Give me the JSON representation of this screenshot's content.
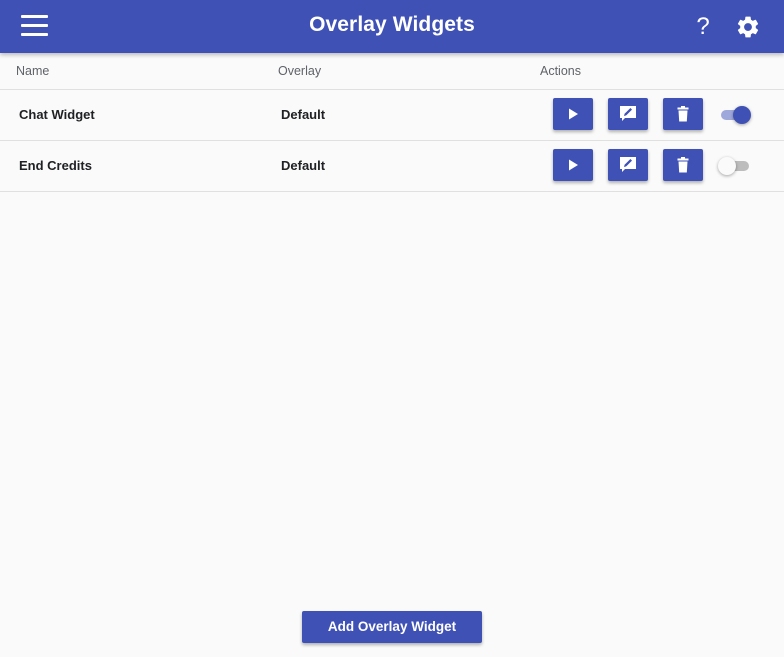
{
  "appbar": {
    "title": "Overlay Widgets",
    "help_label": "?",
    "menu_icon": "hamburger-menu-icon",
    "settings_icon": "gear-icon"
  },
  "table": {
    "columns": [
      "Name",
      "Overlay",
      "Actions"
    ],
    "rows": [
      {
        "name": "Chat Widget",
        "overlay": "Default",
        "enabled": true
      },
      {
        "name": "End Credits",
        "overlay": "Default",
        "enabled": false
      }
    ],
    "action_icons": [
      "play-icon",
      "edit-icon",
      "delete-icon"
    ]
  },
  "footer": {
    "add_label": "Add Overlay Widget"
  },
  "colors": {
    "primary": "#3f51b5",
    "toggle_on_track": "#9fa8da",
    "toggle_off_track": "#bdbdbd",
    "background": "#fafafa"
  }
}
